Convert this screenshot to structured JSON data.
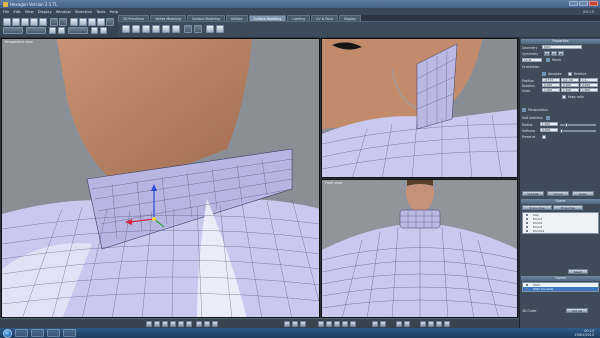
{
  "window": {
    "title": "Hexagon Version 2.5 TL"
  },
  "menu": {
    "items": [
      "File",
      "Edit",
      "View",
      "Display",
      "Window",
      "Selection",
      "Tools",
      "Help"
    ],
    "status": "00:13"
  },
  "tabs": [
    {
      "label": "3D Primitives",
      "active": false
    },
    {
      "label": "Vertex Modeling",
      "active": false
    },
    {
      "label": "Surface Modeling",
      "active": false
    },
    {
      "label": "Utilities",
      "active": false
    },
    {
      "label": "Surface Modeling",
      "active": true
    },
    {
      "label": "Lighting",
      "active": false
    },
    {
      "label": "UV & Paint",
      "active": false
    },
    {
      "label": "Display",
      "active": false
    }
  ],
  "viewports": {
    "main_label": "Perspective view",
    "bottom_right_label": "Front view"
  },
  "panel": {
    "properties_title": "Properties",
    "geometry_label": "Geometry",
    "object_name": "Shirt",
    "symmetry_label": "Symmetry",
    "axis_labels": [
      "X",
      "Y",
      "Z"
    ],
    "dropdown_value": "Local",
    "world_label": "World",
    "orientation_label": "Orientation",
    "orientation_options": [
      "Absolute",
      "Relative"
    ],
    "position_label": "Position",
    "position_values": [
      "-0.777",
      "4.2..00",
      "1.1..."
    ],
    "rotation_label": "Rotation",
    "rotation_values": [
      "0.000",
      "0.000",
      "0.000"
    ],
    "scale_label": "Scale",
    "scale_values": [
      "1.000",
      "1.000",
      "1.000"
    ],
    "keep_ratio_label": "Keep ratio",
    "manipulation_label": "Manipulation",
    "soft_selection_label": "Soft selection",
    "radius_label": "Radius",
    "radius_value": "1.000",
    "softness_label": "Softness",
    "softness_value": "0.000",
    "preserve_label": "Preserve",
    "validate_label": "Validate",
    "cancel_label": "Cancel",
    "apply_label": "Apply",
    "scene_tree_title": "Scene",
    "scene_tabs": [
      "Scene tree",
      "Properties"
    ],
    "scene_items": [
      "Cap",
      "Form1",
      "Form2",
      "Form3",
      "Form04"
    ],
    "select_label": "Select",
    "layers_title": "Layers",
    "layer_items": [
      "Shirt",
      "Shirt (current)"
    ],
    "lib_label": "3D Guide",
    "lib_button": "Add obj"
  },
  "taskbar": {
    "time": "00:13",
    "date": "23/01/2012"
  },
  "colors": {
    "mesh": "#c9c8ee",
    "wire": "#3c3f66",
    "skin": "#b98464",
    "accent": "#3a76c2"
  }
}
